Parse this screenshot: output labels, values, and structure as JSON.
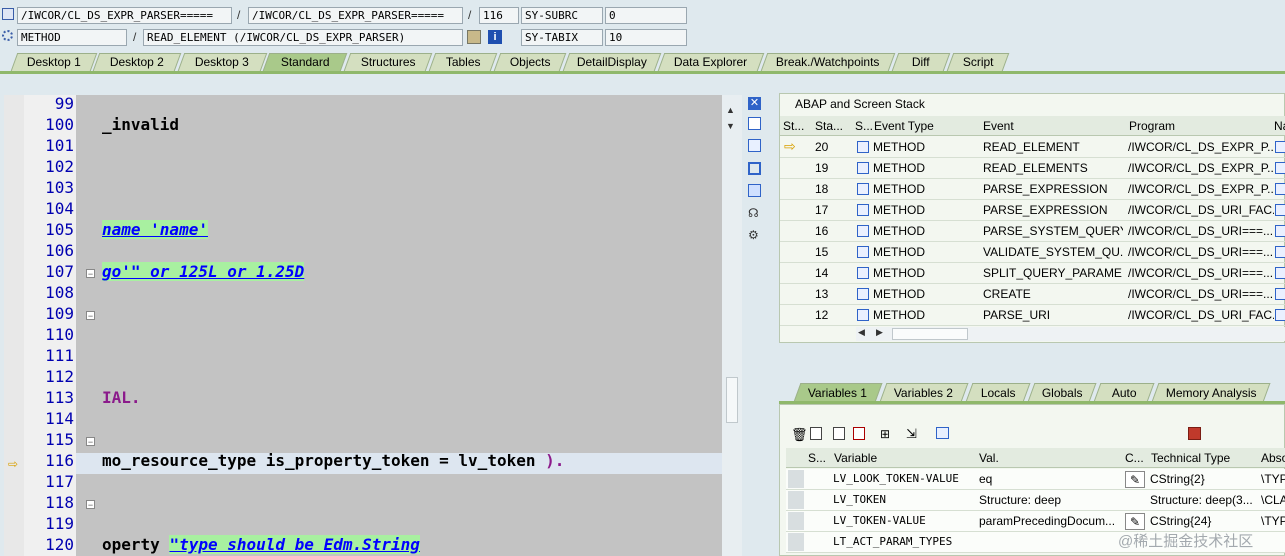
{
  "header": {
    "row1": {
      "program1": "/IWCOR/CL_DS_EXPR_PARSER=====",
      "program2": "/IWCOR/CL_DS_EXPR_PARSER=====",
      "line": "116",
      "sysvar_name": "SY-SUBRC",
      "sysvar_value": "0"
    },
    "row2": {
      "event_type": "METHOD",
      "event": "READ_ELEMENT (/IWCOR/CL_DS_EXPR_PARSER)",
      "sysvar_name": "SY-TABIX",
      "sysvar_value": "10"
    },
    "separator": "/"
  },
  "tabs": [
    "Desktop 1",
    "Desktop 2",
    "Desktop 3",
    "Standard",
    "Structures",
    "Tables",
    "Objects",
    "DetailDisplay",
    "Data Explorer",
    "Break./Watchpoints",
    "Diff",
    "Script"
  ],
  "active_tab": "Standard",
  "editor": {
    "lines": [
      {
        "no": "99",
        "text": ""
      },
      {
        "no": "100",
        "text": "_invalid"
      },
      {
        "no": "101",
        "text": ""
      },
      {
        "no": "102",
        "text": ""
      },
      {
        "no": "103",
        "text": ""
      },
      {
        "no": "104",
        "text": ""
      },
      {
        "no": "105",
        "text": "name 'name'"
      },
      {
        "no": "106",
        "text": ""
      },
      {
        "no": "107",
        "text": "go'\" or 125L or 1.25D"
      },
      {
        "no": "108",
        "text": ""
      },
      {
        "no": "109",
        "text": ""
      },
      {
        "no": "110",
        "text": ""
      },
      {
        "no": "111",
        "text": ""
      },
      {
        "no": "112",
        "text": ""
      },
      {
        "no": "113",
        "text": "IAL."
      },
      {
        "no": "114",
        "text": ""
      },
      {
        "no": "115",
        "text": ""
      },
      {
        "no": "116",
        "text": "mo_resource_type is_property_token = lv_token )."
      },
      {
        "no": "117",
        "text": ""
      },
      {
        "no": "118",
        "text": ""
      },
      {
        "no": "119",
        "text": ""
      },
      {
        "no": "120",
        "text": "operty "
      }
    ],
    "line120_comment": "\"type should be Edm.String"
  },
  "stack": {
    "title": "ABAP and Screen Stack",
    "columns": [
      "St...",
      "Sta...",
      "S...",
      "Event Type",
      "Event",
      "Program",
      "Na"
    ],
    "rows": [
      {
        "level": "20",
        "type": "METHOD",
        "event": "READ_ELEMENT",
        "program": "/IWCOR/CL_DS_EXPR_P..."
      },
      {
        "level": "19",
        "type": "METHOD",
        "event": "READ_ELEMENTS",
        "program": "/IWCOR/CL_DS_EXPR_P..."
      },
      {
        "level": "18",
        "type": "METHOD",
        "event": "PARSE_EXPRESSION",
        "program": "/IWCOR/CL_DS_EXPR_P..."
      },
      {
        "level": "17",
        "type": "METHOD",
        "event": "PARSE_EXPRESSION",
        "program": "/IWCOR/CL_DS_URI_FAC..."
      },
      {
        "level": "16",
        "type": "METHOD",
        "event": "PARSE_SYSTEM_QUERY...",
        "program": "/IWCOR/CL_DS_URI===..."
      },
      {
        "level": "15",
        "type": "METHOD",
        "event": "VALIDATE_SYSTEM_QU...",
        "program": "/IWCOR/CL_DS_URI===..."
      },
      {
        "level": "14",
        "type": "METHOD",
        "event": "SPLIT_QUERY_PARAME...",
        "program": "/IWCOR/CL_DS_URI===..."
      },
      {
        "level": "13",
        "type": "METHOD",
        "event": "CREATE",
        "program": "/IWCOR/CL_DS_URI===..."
      },
      {
        "level": "12",
        "type": "METHOD",
        "event": "PARSE_URI",
        "program": "/IWCOR/CL_DS_URI_FAC..."
      }
    ]
  },
  "var_tabs": [
    "Variables 1",
    "Variables 2",
    "Locals",
    "Globals",
    "Auto",
    "Memory Analysis"
  ],
  "variables": {
    "columns": [
      "S...",
      "Variable",
      "Val.",
      "C...",
      "Technical Type",
      "Abso"
    ],
    "rows": [
      {
        "variable": "LV_LOOK_TOKEN-VALUE",
        "value": "eq",
        "tech_type": "CString{2}",
        "abs": "\\TYP"
      },
      {
        "variable": "LV_TOKEN",
        "value": "Structure: deep",
        "tech_type": "Structure: deep(3...",
        "abs": "\\CLA"
      },
      {
        "variable": "LV_TOKEN-VALUE",
        "value": "paramPrecedingDocum...",
        "tech_type": "CString{24}",
        "abs": "\\TYP"
      },
      {
        "variable": "LT_ACT_PARAM_TYPES",
        "value": "",
        "tech_type": "",
        "abs": ""
      }
    ]
  },
  "watermark": "@稀土掘金技术社区",
  "colors": {
    "accent": "#a9c98a",
    "current_line": "#dde6f0",
    "keyword_green": "#a8f0a0"
  }
}
